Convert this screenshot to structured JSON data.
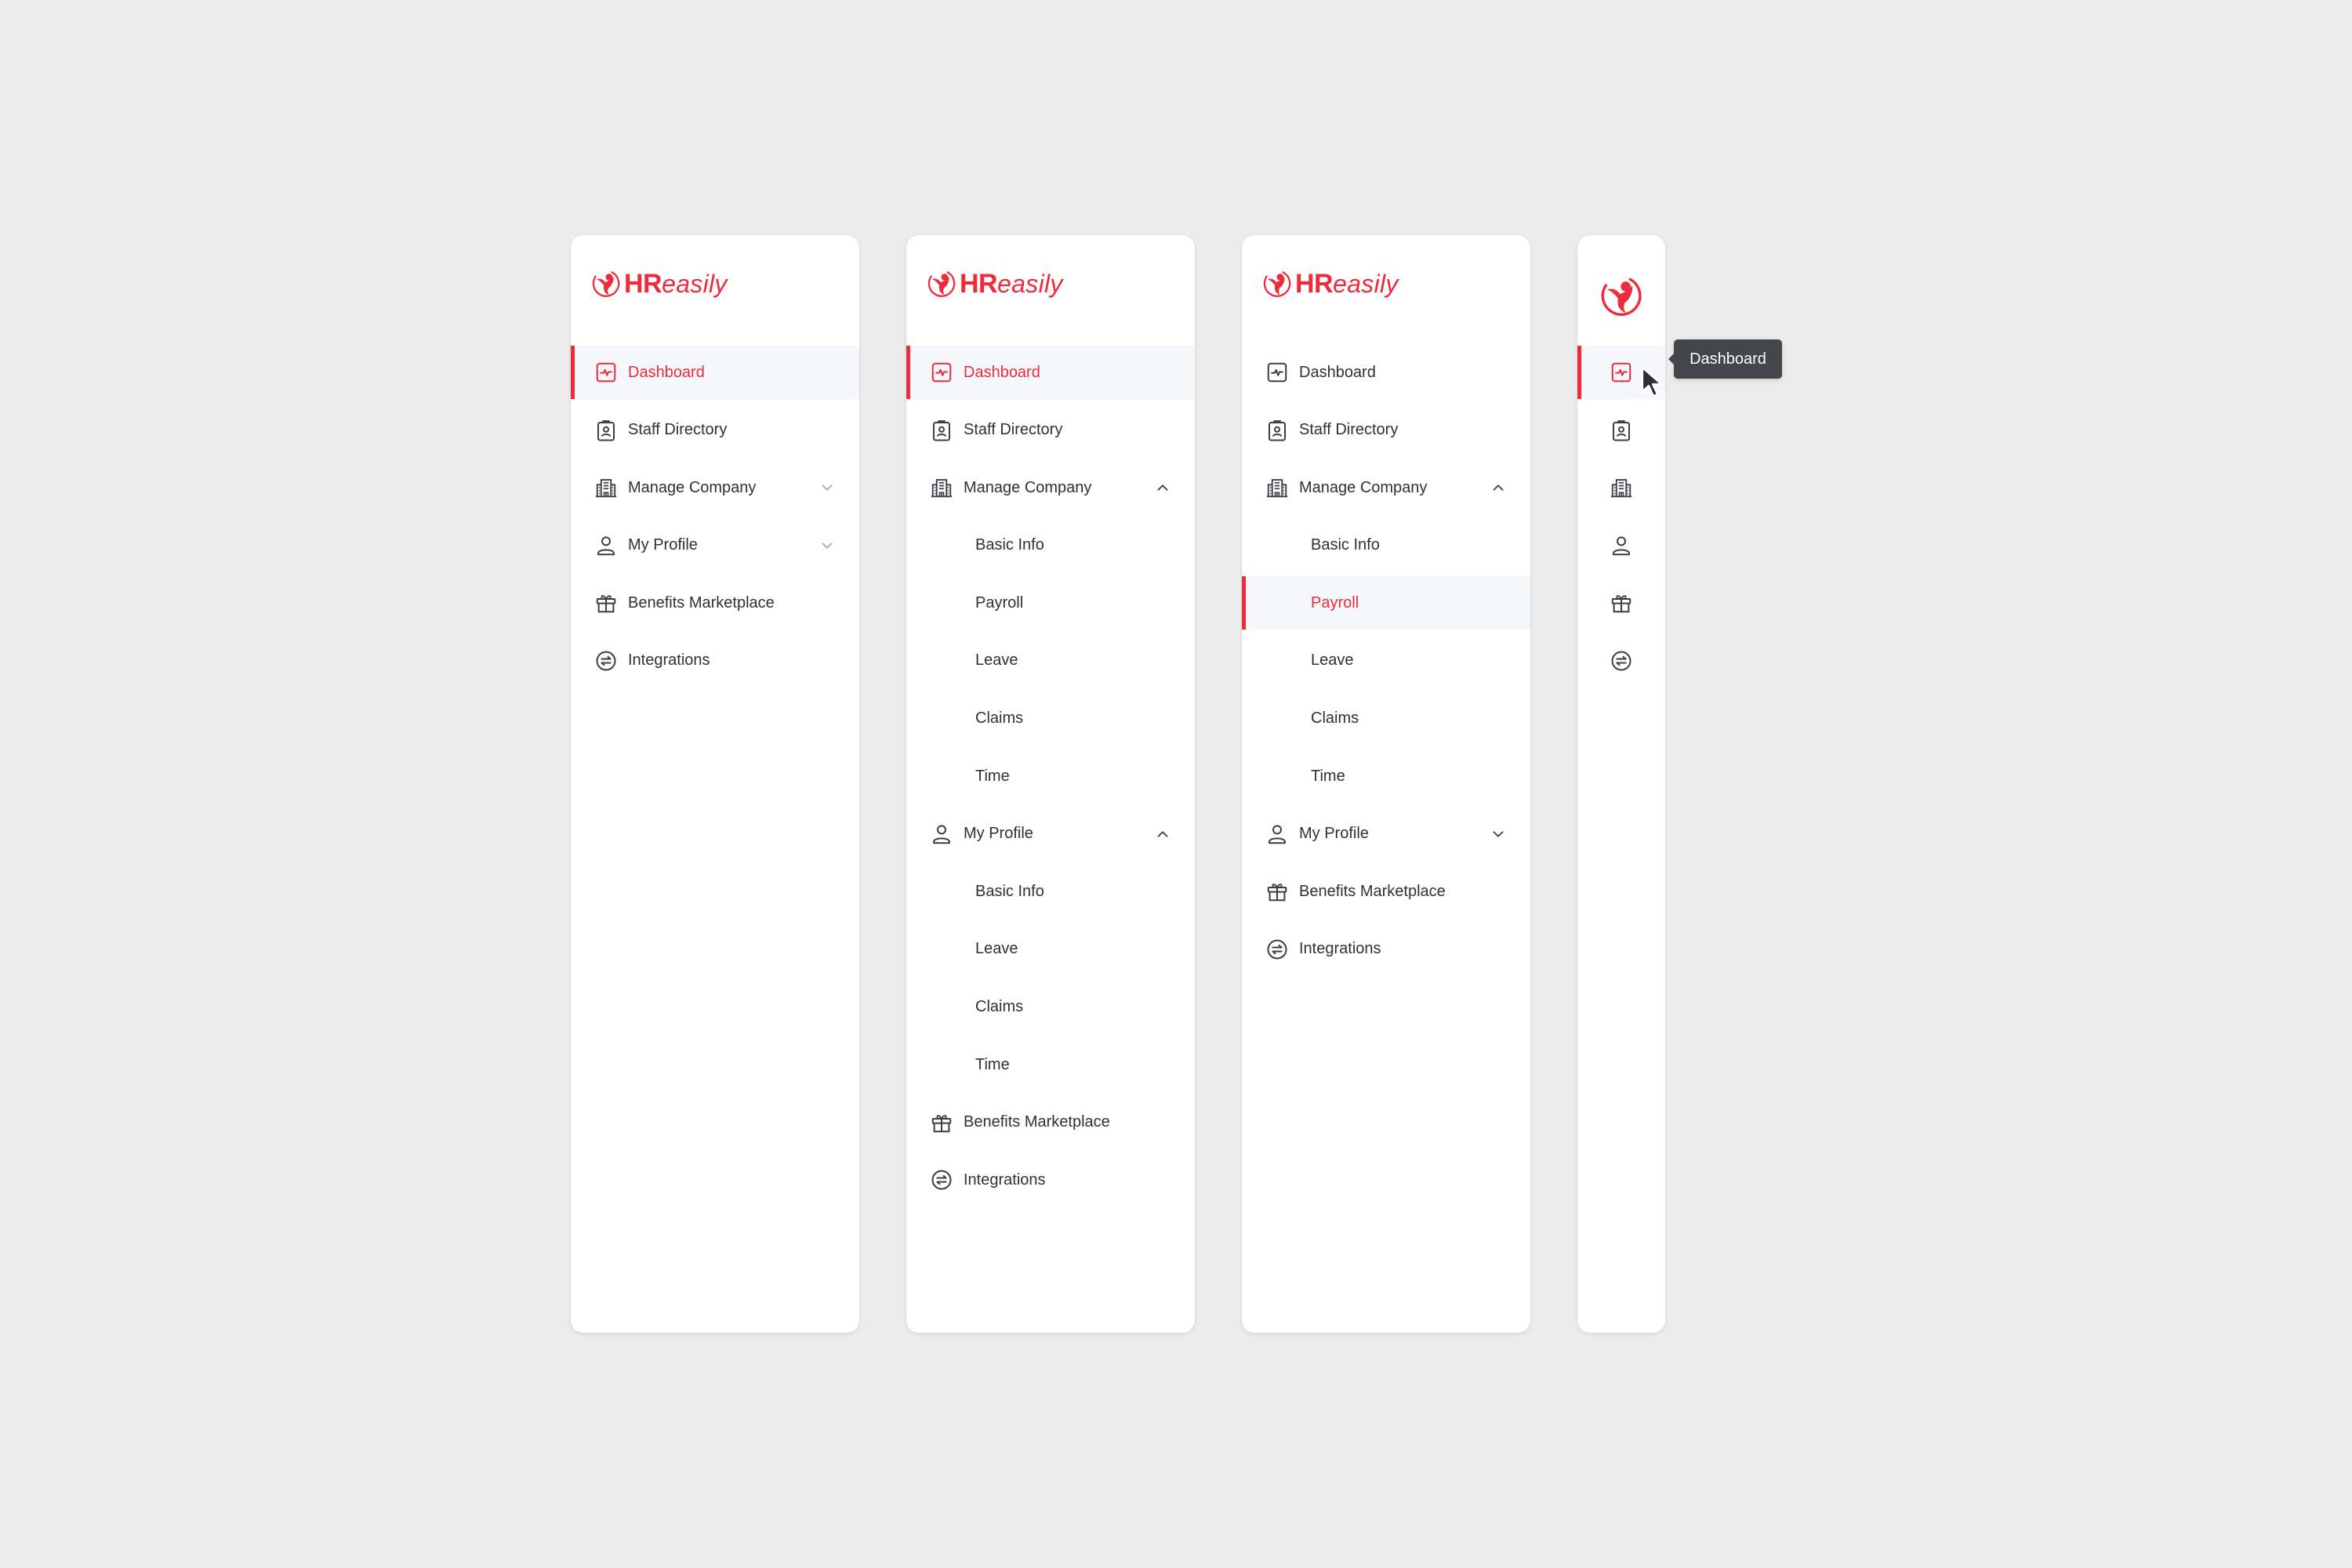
{
  "brand": {
    "name_bold": "HR",
    "name_light": "easily",
    "accent_color": "#EE2B3B",
    "logo_icon": "hreasily-logo-icon"
  },
  "colors": {
    "background": "#ECECEC",
    "panel": "#FFFFFF",
    "active_row_bg": "#F6F7FA",
    "text": "#2E3135",
    "tooltip_bg": "#43464B"
  },
  "panels": [
    {
      "variant": "expanded-default",
      "items": [
        {
          "label": "Dashboard",
          "icon": "activity-chart-icon",
          "active": true
        },
        {
          "label": "Staff Directory",
          "icon": "id-badge-icon"
        },
        {
          "label": "Manage Company",
          "icon": "building-icon",
          "chevron": "chevron-down-icon"
        },
        {
          "label": "My Profile",
          "icon": "user-icon",
          "chevron": "chevron-down-icon"
        },
        {
          "label": "Benefits Marketplace",
          "icon": "gift-icon"
        },
        {
          "label": "Integrations",
          "icon": "swap-arrows-circle-icon"
        }
      ]
    },
    {
      "variant": "expanded-all-open",
      "items": [
        {
          "label": "Dashboard",
          "icon": "activity-chart-icon",
          "active": true
        },
        {
          "label": "Staff Directory",
          "icon": "id-badge-icon"
        },
        {
          "label": "Manage Company",
          "icon": "building-icon",
          "chevron": "chevron-up-icon",
          "children": [
            "Basic Info",
            "Payroll",
            "Leave",
            "Claims",
            "Time"
          ]
        },
        {
          "label": "My Profile",
          "icon": "user-icon",
          "chevron": "chevron-up-icon",
          "children": [
            "Basic Info",
            "Leave",
            "Claims",
            "Time"
          ]
        },
        {
          "label": "Benefits Marketplace",
          "icon": "gift-icon"
        },
        {
          "label": "Integrations",
          "icon": "swap-arrows-circle-icon"
        }
      ]
    },
    {
      "variant": "expanded-sub-active",
      "items": [
        {
          "label": "Dashboard",
          "icon": "activity-chart-icon"
        },
        {
          "label": "Staff Directory",
          "icon": "id-badge-icon"
        },
        {
          "label": "Manage Company",
          "icon": "building-icon",
          "chevron": "chevron-up-icon",
          "children": [
            "Basic Info",
            "Payroll",
            "Leave",
            "Claims",
            "Time"
          ],
          "active_child": "Payroll"
        },
        {
          "label": "My Profile",
          "icon": "user-icon",
          "chevron": "chevron-down-icon"
        },
        {
          "label": "Benefits Marketplace",
          "icon": "gift-icon"
        },
        {
          "label": "Integrations",
          "icon": "swap-arrows-circle-icon"
        }
      ]
    },
    {
      "variant": "collapsed",
      "items": [
        {
          "label": "Dashboard",
          "icon": "activity-chart-icon",
          "active": true
        },
        {
          "label": "Staff Directory",
          "icon": "id-badge-icon"
        },
        {
          "label": "Manage Company",
          "icon": "building-icon"
        },
        {
          "label": "My Profile",
          "icon": "user-icon"
        },
        {
          "label": "Benefits Marketplace",
          "icon": "gift-icon"
        },
        {
          "label": "Integrations",
          "icon": "swap-arrows-circle-icon"
        }
      ]
    }
  ],
  "p": {
    "dashboard": "Dashboard",
    "staff_directory": "Staff Directory",
    "manage_company": "Manage Company",
    "my_profile": "My Profile",
    "benefits": "Benefits Marketplace",
    "integrations": "Integrations",
    "basic_info": "Basic Info",
    "payroll": "Payroll",
    "leave": "Leave",
    "claims": "Claims",
    "time": "Time"
  },
  "tooltip": {
    "text": "Dashboard"
  }
}
